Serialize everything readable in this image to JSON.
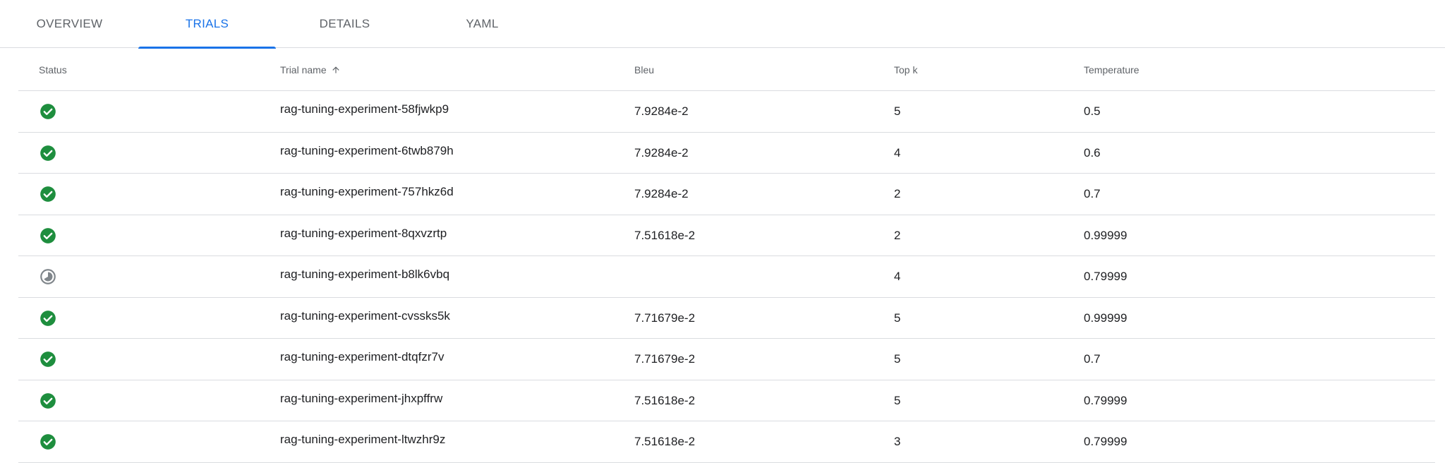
{
  "tabs": [
    {
      "label": "OVERVIEW",
      "active": false
    },
    {
      "label": "TRIALS",
      "active": true
    },
    {
      "label": "DETAILS",
      "active": false
    },
    {
      "label": "YAML",
      "active": false
    }
  ],
  "table": {
    "headers": {
      "status": "Status",
      "trial_name": "Trial name",
      "bleu": "Bleu",
      "top_k": "Top k",
      "temperature": "Temperature"
    },
    "sort": {
      "column": "trial_name",
      "direction": "ascending",
      "icon": "arrow-upward-icon"
    },
    "rows": [
      {
        "status": "succeeded",
        "trial_name": "rag-tuning-experiment-58fjwkp9",
        "bleu": "7.9284e-2",
        "top_k": "5",
        "temperature": "0.5"
      },
      {
        "status": "succeeded",
        "trial_name": "rag-tuning-experiment-6twb879h",
        "bleu": "7.9284e-2",
        "top_k": "4",
        "temperature": "0.6"
      },
      {
        "status": "succeeded",
        "trial_name": "rag-tuning-experiment-757hkz6d",
        "bleu": "7.9284e-2",
        "top_k": "2",
        "temperature": "0.7"
      },
      {
        "status": "succeeded",
        "trial_name": "rag-tuning-experiment-8qxvzrtp",
        "bleu": "7.51618e-2",
        "top_k": "2",
        "temperature": "0.99999"
      },
      {
        "status": "running",
        "trial_name": "rag-tuning-experiment-b8lk6vbq",
        "bleu": "",
        "top_k": "4",
        "temperature": "0.79999"
      },
      {
        "status": "succeeded",
        "trial_name": "rag-tuning-experiment-cvssks5k",
        "bleu": "7.71679e-2",
        "top_k": "5",
        "temperature": "0.99999"
      },
      {
        "status": "succeeded",
        "trial_name": "rag-tuning-experiment-dtqfzr7v",
        "bleu": "7.71679e-2",
        "top_k": "5",
        "temperature": "0.7"
      },
      {
        "status": "succeeded",
        "trial_name": "rag-tuning-experiment-jhxpffrw",
        "bleu": "7.51618e-2",
        "top_k": "5",
        "temperature": "0.79999"
      },
      {
        "status": "succeeded",
        "trial_name": "rag-tuning-experiment-ltwzhr9z",
        "bleu": "7.51618e-2",
        "top_k": "3",
        "temperature": "0.79999"
      }
    ]
  },
  "colors": {
    "accent": "#1a73e8",
    "success": "#1e8e3e",
    "running": "#80868b"
  }
}
